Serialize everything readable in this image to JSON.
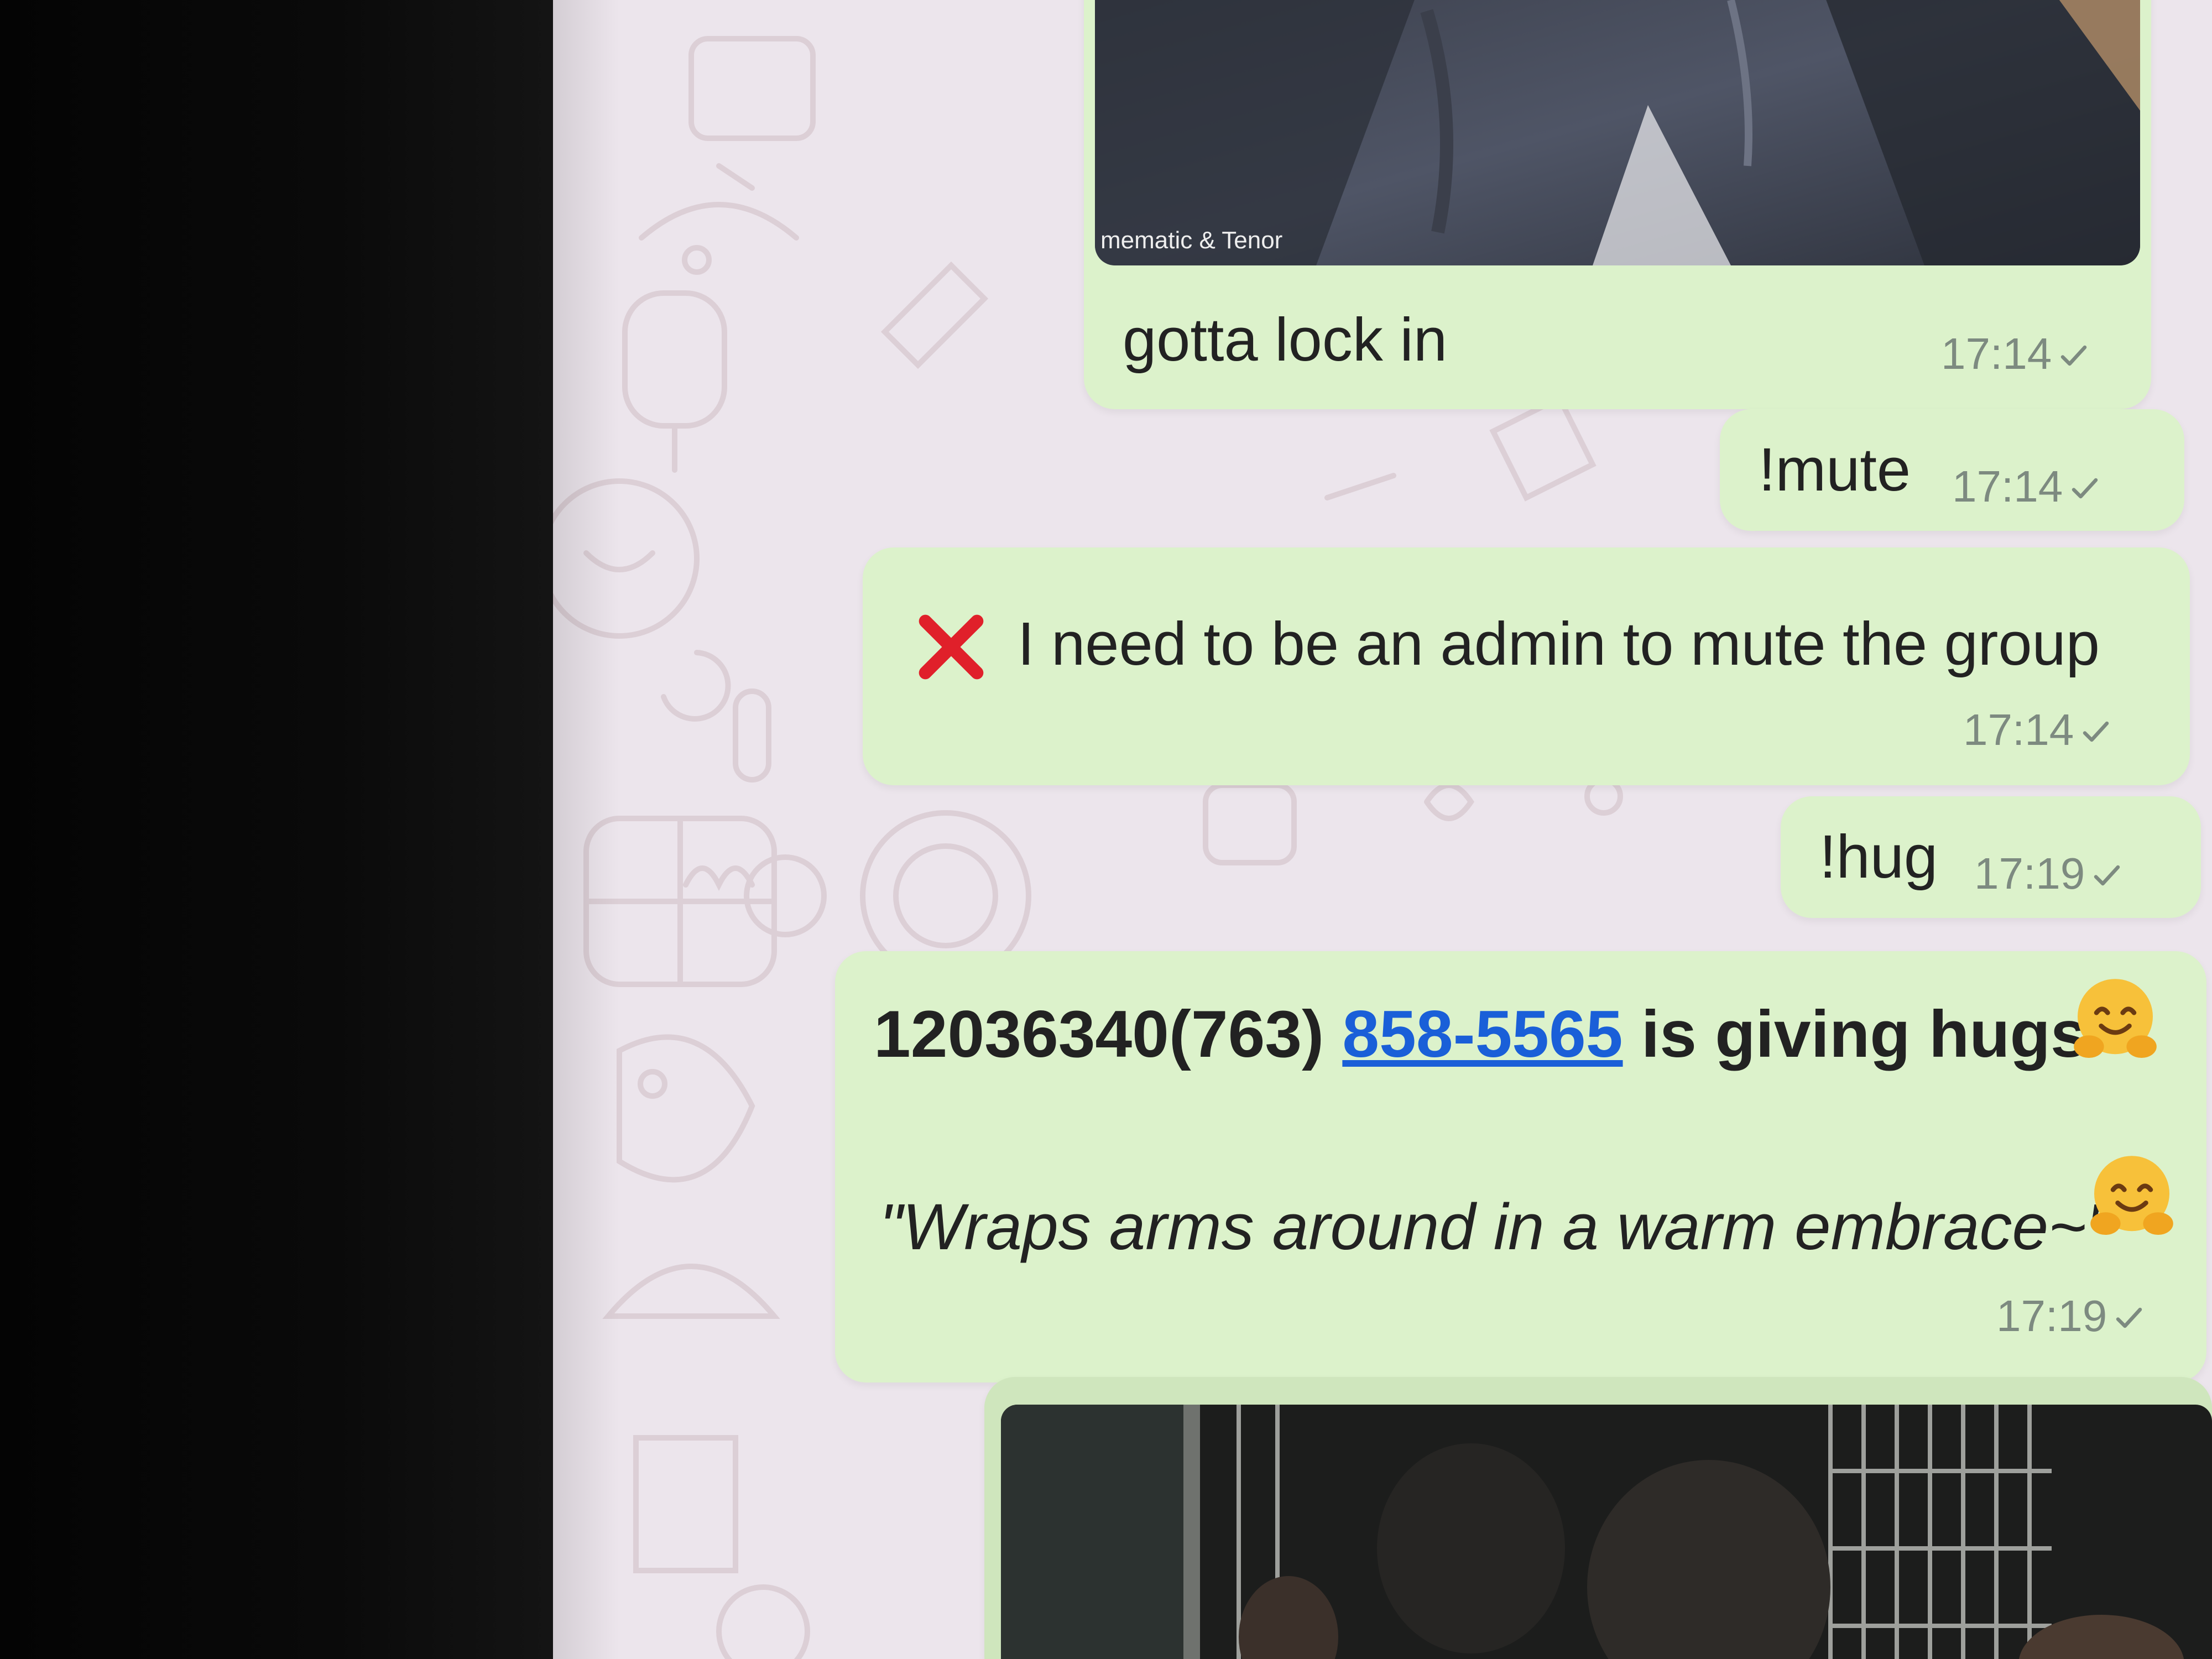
{
  "chat": {
    "messages": [
      {
        "id": "m1",
        "type": "gif",
        "attribution": "mematic & Tenor",
        "caption": "gotta lock in",
        "time": "17:14"
      },
      {
        "id": "m2",
        "type": "text",
        "text": "!mute",
        "time": "17:14"
      },
      {
        "id": "m3",
        "type": "text",
        "text": "I need to be an admin to mute the group",
        "icon": "cross-mark-icon",
        "time": "17:14"
      },
      {
        "id": "m4",
        "type": "text",
        "text": "!hug",
        "time": "17:19"
      },
      {
        "id": "m5",
        "type": "text",
        "sender_prefix": "12036340(763) ",
        "phone_link": "858-5565",
        "suffix": " is giving hugs",
        "quote": "\"Wraps arms around in a warm embrace~\"",
        "emoji": "hugging-face-emoji",
        "time": "17:19"
      },
      {
        "id": "m6",
        "type": "image"
      }
    ]
  },
  "colors": {
    "bubble_bg": "#dcf2cb",
    "wallpaper_bg": "#ece5ec",
    "link": "#1a5fd8",
    "cross_red": "#e0202a",
    "timestamp": "#7d8a80"
  },
  "icons": {
    "read_receipt": "check-icon",
    "error": "cross-mark-icon",
    "emoji": "hugging-face-emoji"
  }
}
